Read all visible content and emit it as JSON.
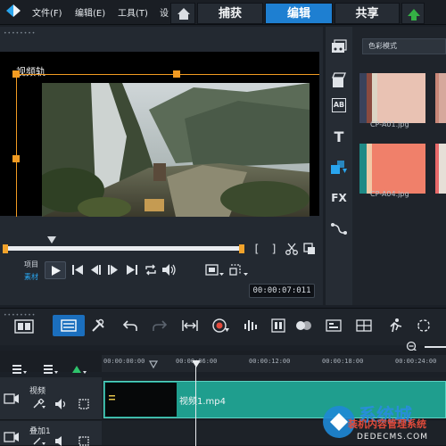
{
  "menu": {
    "file": "文件(F)",
    "edit": "编辑(E)",
    "tools": "工具(T)",
    "settings_partial": "设"
  },
  "tabs": [
    {
      "label": "捕获"
    },
    {
      "label": "编辑",
      "active": true
    },
    {
      "label": "共享"
    }
  ],
  "player": {
    "track_label": "视频轨",
    "mode_project": "项目",
    "mode_clip": "素材",
    "timecode": "00:00:07:011",
    "bracket_in": "[",
    "bracket_out": "]"
  },
  "library": {
    "dropdown_value": "色彩模式",
    "thumbnails": [
      {
        "label": "CP-A01.jpg"
      },
      {
        "label": "CP-A04.jpg"
      }
    ]
  },
  "timeline": {
    "ruler_ticks": [
      "00:00:00:00",
      "00:00:06:00",
      "00:00:12:00",
      "00:00:18:00",
      "00:00:24:00"
    ],
    "tracks": [
      {
        "name": "视频"
      },
      {
        "name": "叠加1"
      }
    ],
    "clip_name": "视频1.mp4"
  },
  "watermark": {
    "text": "系统城",
    "subtext": "装机内容管理系统",
    "url": "DEDECMS.COM"
  },
  "colors": {
    "accent": "#1e7fd1",
    "trim_orange": "#f29b22",
    "clip_teal": "#1f9e8e",
    "library_active_icon": "#29a5ee"
  }
}
